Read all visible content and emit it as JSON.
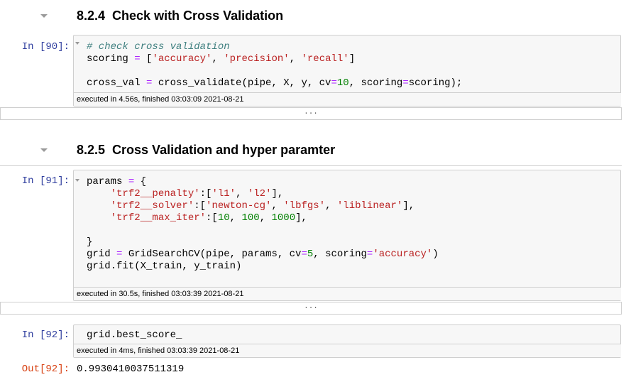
{
  "sections": [
    {
      "title": "8.2.4  Check with Cross Validation"
    },
    {
      "title": "8.2.5  Cross Validation and hyper paramter"
    }
  ],
  "cells": [
    {
      "prompt": "In [90]:",
      "code": [
        "# check cross validation",
        "scoring = ['accuracy', 'precision', 'recall']",
        "",
        "cross_val = cross_validate(pipe, X, y, cv=10, scoring=scoring);"
      ],
      "exec_info": "executed in 4.56s, finished 03:03:09 2021-08-21",
      "output_collapsed": "..."
    },
    {
      "prompt": "In [91]:",
      "code": [
        "params = {",
        "    'trf2__penalty':['l1', 'l2'],",
        "    'trf2__solver':['newton-cg', 'lbfgs', 'liblinear'],",
        "    'trf2__max_iter':[10, 100, 1000],",
        "",
        "}",
        "grid = GridSearchCV(pipe, params, cv=5, scoring='accuracy')",
        "grid.fit(X_train, y_train)"
      ],
      "exec_info": "executed in 30.5s, finished 03:03:39 2021-08-21",
      "output_collapsed": "..."
    },
    {
      "prompt": "In [92]:",
      "code": [
        "grid.best_score_"
      ],
      "exec_info": "executed in 4ms, finished 03:03:39 2021-08-21",
      "out_prompt": "Out[92]:",
      "output": "0.9930410037511319"
    }
  ]
}
